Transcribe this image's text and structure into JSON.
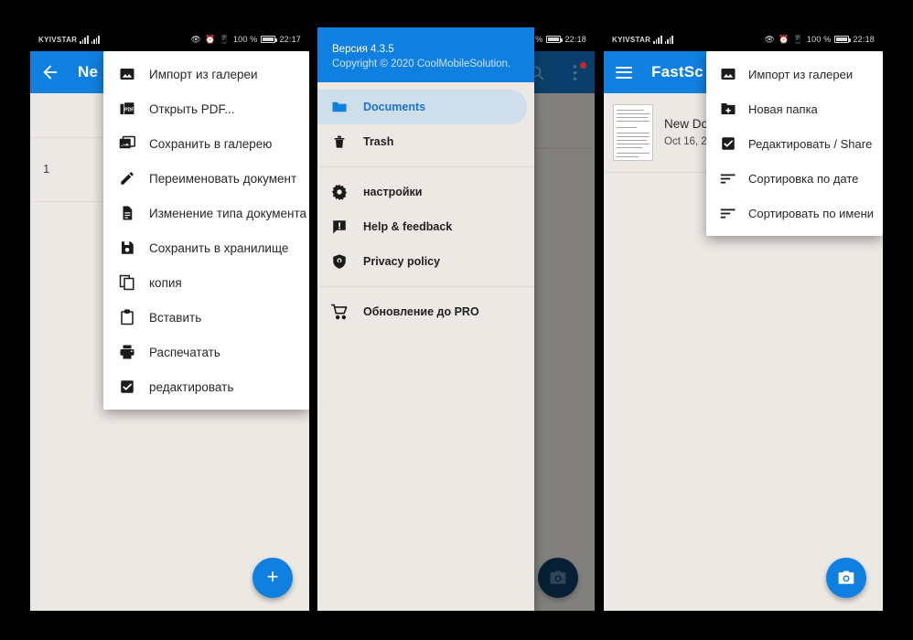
{
  "status_bar": {
    "carrier": "KYIVSTAR",
    "battery_text": "100 %",
    "time_p1": "22:17",
    "time_p2": "22:18",
    "time_p3": "22:18",
    "icons": [
      "eye-icon",
      "alarm-icon",
      "vibrate-icon",
      "battery-icon"
    ]
  },
  "panel1": {
    "appbar": {
      "back_icon": "arrow-back-icon",
      "title": "Ne"
    },
    "page_number": "1",
    "fab": {
      "icon": "plus-icon",
      "color": "#1080e0"
    },
    "menu": [
      {
        "icon": "image-icon",
        "label": "Импорт из галереи"
      },
      {
        "icon": "pdf-icon",
        "label": "Открыть PDF..."
      },
      {
        "icon": "gallery-save-icon",
        "label": "Сохранить в галерею"
      },
      {
        "icon": "pencil-icon",
        "label": "Переименовать документ"
      },
      {
        "icon": "document-icon",
        "label": "Изменение типа документа"
      },
      {
        "icon": "save-disk-icon",
        "label": "Сохранить в хранилище"
      },
      {
        "icon": "copy-icon",
        "label": "копия"
      },
      {
        "icon": "paste-icon",
        "label": "Вставить"
      },
      {
        "icon": "printer-icon",
        "label": "Распечатать"
      },
      {
        "icon": "checkbox-icon",
        "label": "редактировать"
      }
    ]
  },
  "panel2": {
    "appbar": {
      "search_icon": "search-icon",
      "overflow_icon": "more-vert-icon",
      "badge": true
    },
    "drawer": {
      "version": "Версия 4.3.5",
      "copyright": "Copyright © 2020 CoolMobileSolution.",
      "group1": [
        {
          "icon": "folder-icon",
          "label": "Documents",
          "active": true
        },
        {
          "icon": "trash-icon",
          "label": "Trash",
          "active": false
        }
      ],
      "group2": [
        {
          "icon": "gear-icon",
          "label": "настройки"
        },
        {
          "icon": "feedback-icon",
          "label": "Help & feedback"
        },
        {
          "icon": "shield-icon",
          "label": "Privacy policy"
        }
      ],
      "group3": [
        {
          "icon": "cart-icon",
          "label": "Обновление до PRO"
        }
      ]
    },
    "fab": {
      "icon": "camera-icon",
      "color": "#0b3a60"
    }
  },
  "panel3": {
    "appbar": {
      "menu_icon": "hamburger-icon",
      "title": "FastSc"
    },
    "document": {
      "title": "New Do",
      "date": "Oct 16, 2",
      "thumb": "document-thumbnail"
    },
    "fab": {
      "icon": "camera-icon",
      "color": "#1080e0"
    },
    "menu": [
      {
        "icon": "image-icon",
        "label": "Импорт из галереи"
      },
      {
        "icon": "new-folder-icon",
        "label": "Новая папка"
      },
      {
        "icon": "checkbox-icon",
        "label": "Редактировать / Share"
      },
      {
        "icon": "sort-icon",
        "label": "Сортировка по дате"
      },
      {
        "icon": "sort-icon",
        "label": "Сортировать по имени"
      }
    ]
  },
  "colors": {
    "primary": "#1080e0",
    "surface": "#ece9e4",
    "accent_badge": "#c62828"
  }
}
